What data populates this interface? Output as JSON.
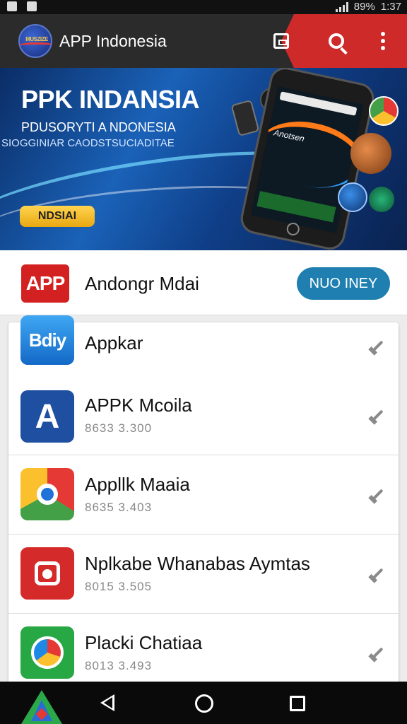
{
  "status_bar": {
    "battery": "89%",
    "time": "1:37"
  },
  "app_bar": {
    "title": "APP Indonesia",
    "logo_text": "MUSZIZE"
  },
  "banner": {
    "title": "PPK INDANSIA",
    "subtitle": "PDUSORYTI A NDONESIA",
    "tagline": "SIOGGINIAR CAODSTSUCIADITAE",
    "cta_label": "NDSIAI",
    "phone_screen_text": "Anotsen"
  },
  "featured": {
    "icon_text": "APP",
    "name": "Andongr Mdai",
    "button_label": "NUO INEY"
  },
  "apps": [
    {
      "name": "Appkar",
      "meta": "",
      "icon": "bdiy",
      "icon_text": "Bdiy"
    },
    {
      "name": "APPK Mcoila",
      "meta": "8633 3.300",
      "icon": "a",
      "icon_text": "A"
    },
    {
      "name": "Appllk Maaia",
      "meta": "8635 3.403",
      "icon": "chrome",
      "icon_text": ""
    },
    {
      "name": "Nplkabe Whanabas Aymtas",
      "meta": "8015 3.505",
      "icon": "camera",
      "icon_text": ""
    },
    {
      "name": "Placki Chatiaa",
      "meta": "8013 3.493",
      "icon": "maps",
      "icon_text": ""
    }
  ],
  "icons": {
    "header": [
      "store-icon",
      "search-icon",
      "more-vert-icon"
    ],
    "nav": [
      "app-logo-icon",
      "back-icon",
      "home-icon",
      "recents-icon"
    ],
    "row_action": "edit-icon"
  },
  "colors": {
    "app_bar": "#2b2b2b",
    "accent_red": "#cf2a2a",
    "button_blue": "#1f7fb0",
    "banner_cta": "#ffd451"
  }
}
